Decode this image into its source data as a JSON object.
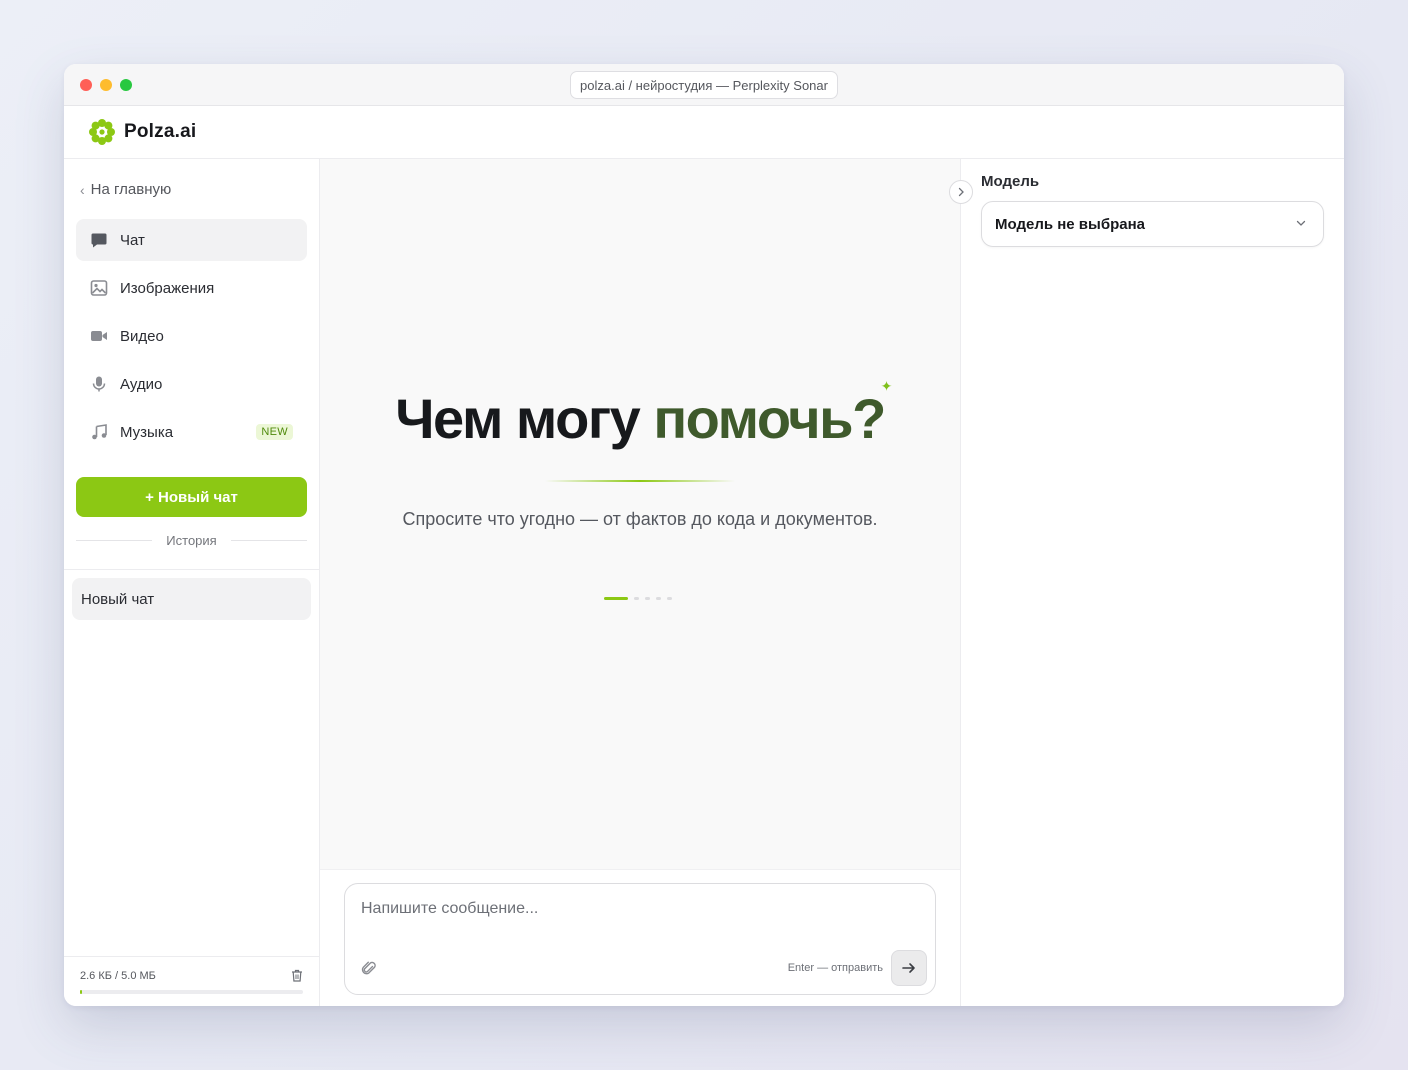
{
  "window": {
    "url": "polza.ai / нейростудия — Perplexity Sonar"
  },
  "brand": {
    "name": "Polza.ai",
    "accent": "#8cc814"
  },
  "sidebar": {
    "back_label": "На главную",
    "items": [
      {
        "label": "Чат",
        "icon": "chat-bubble-icon",
        "active": true
      },
      {
        "label": "Изображения",
        "icon": "image-icon"
      },
      {
        "label": "Видео",
        "icon": "video-camera-icon"
      },
      {
        "label": "Аудио",
        "icon": "microphone-icon"
      },
      {
        "label": "Музыка",
        "icon": "music-note-icon",
        "badge": "NEW"
      }
    ],
    "new_chat_label": "+ Новый чат",
    "history_label": "История",
    "history": [
      {
        "label": "Новый чат"
      }
    ],
    "storage": {
      "text": "2.6 КБ / 5.0 МБ",
      "used_fraction": 0.0005
    }
  },
  "main": {
    "hero_title_plain": "Чем могу ",
    "hero_title_accent": "помочь?",
    "hero_subtitle": "Спросите что угодно — от фактов до кода и документов.",
    "carousel": {
      "count": 5,
      "active_index": 0
    },
    "composer": {
      "placeholder": "Напишите сообщение...",
      "value": "",
      "hint": "Enter — отправить"
    }
  },
  "right_panel": {
    "model_label": "Модель",
    "model_value": "Модель не выбрана"
  }
}
